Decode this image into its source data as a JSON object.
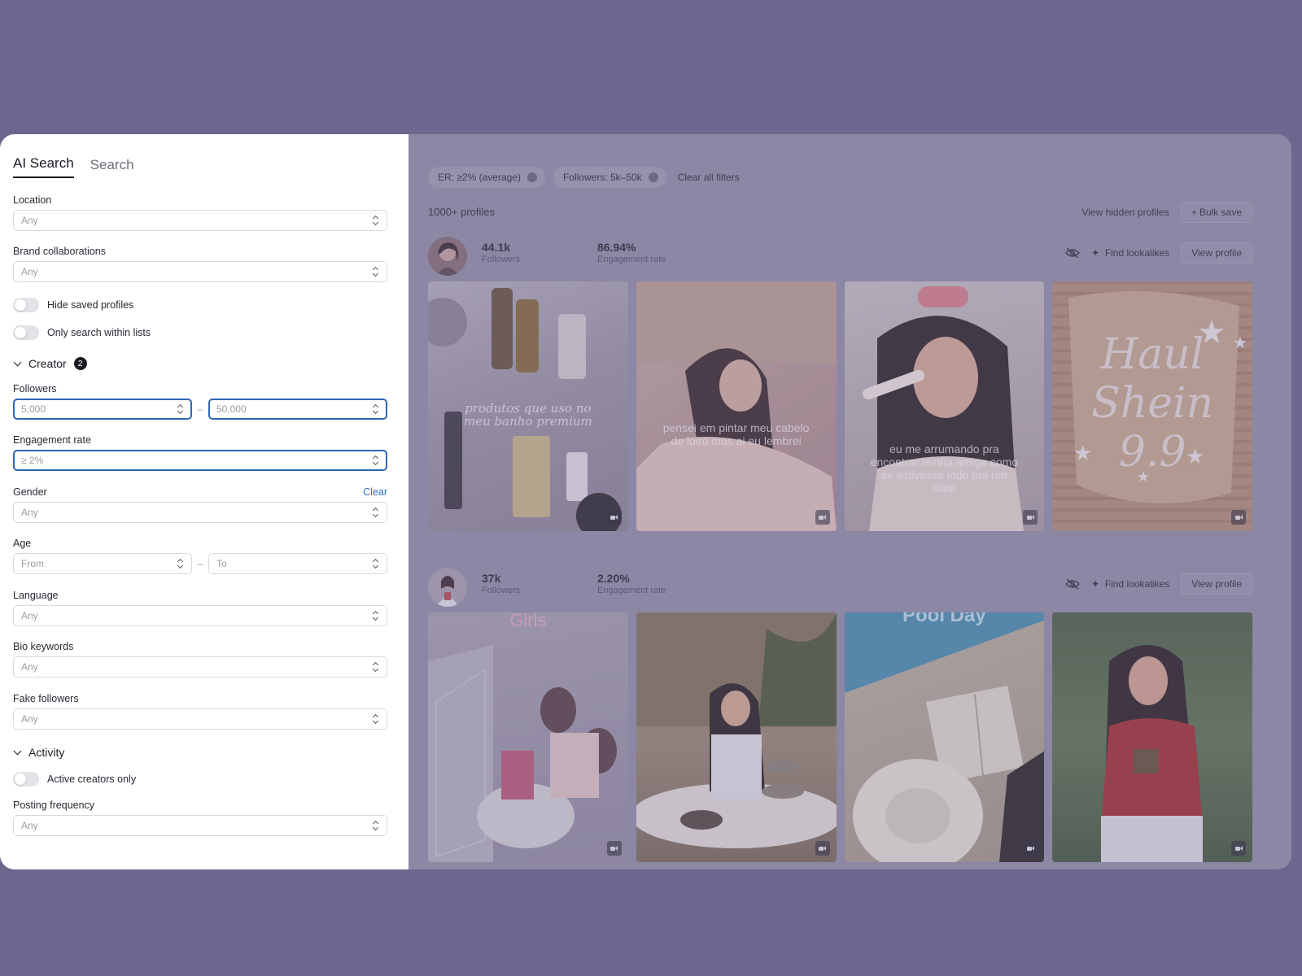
{
  "sidebar": {
    "tabs": [
      {
        "label": "AI Search"
      },
      {
        "label": "Search"
      }
    ],
    "location": {
      "label": "Location",
      "value": "Any"
    },
    "brand": {
      "label": "Brand collaborations",
      "value": "Any"
    },
    "toggles": {
      "hide_saved": "Hide saved profiles",
      "only_lists": "Only search within lists"
    },
    "creator": {
      "title": "Creator",
      "badge": "2"
    },
    "followers": {
      "label": "Followers",
      "min": "5,000",
      "max": "50,000",
      "sep": "–"
    },
    "engagement": {
      "label": "Engagement rate",
      "value": "≥ 2%"
    },
    "gender": {
      "label": "Gender",
      "clear": "Clear",
      "value": "Any"
    },
    "age": {
      "label": "Age",
      "from": "From",
      "to": "To",
      "sep": "–"
    },
    "language": {
      "label": "Language",
      "value": "Any"
    },
    "bio": {
      "label": "Bio keywords",
      "value": "Any"
    },
    "fake": {
      "label": "Fake followers",
      "value": "Any"
    },
    "activity": {
      "title": "Activity",
      "active_only": "Active creators only"
    },
    "posting": {
      "label": "Posting frequency",
      "value": "Any"
    }
  },
  "main": {
    "chips": [
      {
        "label": "ER: ≥2% (average)"
      },
      {
        "label": "Followers: 5k–50k"
      }
    ],
    "clear_all": "Clear all filters",
    "count": "1000+ profiles",
    "view_hidden": "View hidden profiles",
    "bulk_save": "+ Bulk save",
    "find_lookalikes": "Find lookalikes",
    "view_profile": "View profile",
    "profiles": [
      {
        "followers": "44.1k",
        "followers_label": "Followers",
        "er": "86.94%",
        "er_label": "Engagement rate",
        "tiles": [
          {
            "caption": "produtos que uso no meu banho premium"
          },
          {
            "caption": "pensei em pintar meu cabelo de loiro mas ai eu lembrei"
          },
          {
            "caption": "eu me arrumando pra encontrar minha amiga como se estivesse indo pra um date"
          },
          {
            "caption": "Haul Shein 9.9"
          }
        ]
      },
      {
        "followers": "37k",
        "followers_label": "Followers",
        "er": "2.20%",
        "er_label": "Engagement rate",
        "tiles": [
          {
            "caption": "Girls"
          },
          {
            "caption": ""
          },
          {
            "caption": "Pool Day"
          },
          {
            "caption": ""
          }
        ]
      }
    ]
  },
  "colors": {
    "background": "#6e668e",
    "accent": "#3066b3"
  }
}
